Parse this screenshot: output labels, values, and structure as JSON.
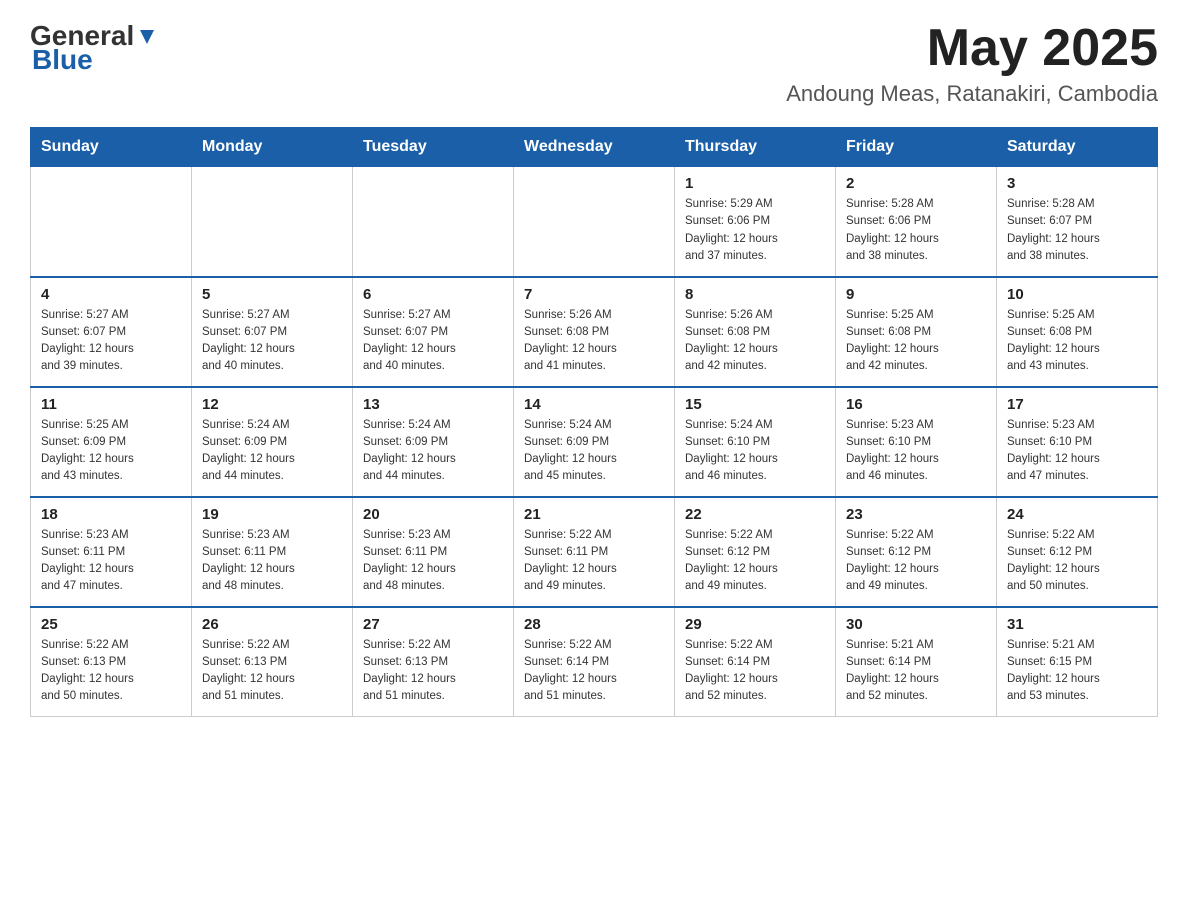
{
  "header": {
    "logo_general": "General",
    "logo_blue": "Blue",
    "month_year": "May 2025",
    "location": "Andoung Meas, Ratanakiri, Cambodia"
  },
  "days_of_week": [
    "Sunday",
    "Monday",
    "Tuesday",
    "Wednesday",
    "Thursday",
    "Friday",
    "Saturday"
  ],
  "weeks": [
    {
      "days": [
        {
          "number": "",
          "info": ""
        },
        {
          "number": "",
          "info": ""
        },
        {
          "number": "",
          "info": ""
        },
        {
          "number": "",
          "info": ""
        },
        {
          "number": "1",
          "info": "Sunrise: 5:29 AM\nSunset: 6:06 PM\nDaylight: 12 hours\nand 37 minutes."
        },
        {
          "number": "2",
          "info": "Sunrise: 5:28 AM\nSunset: 6:06 PM\nDaylight: 12 hours\nand 38 minutes."
        },
        {
          "number": "3",
          "info": "Sunrise: 5:28 AM\nSunset: 6:07 PM\nDaylight: 12 hours\nand 38 minutes."
        }
      ]
    },
    {
      "days": [
        {
          "number": "4",
          "info": "Sunrise: 5:27 AM\nSunset: 6:07 PM\nDaylight: 12 hours\nand 39 minutes."
        },
        {
          "number": "5",
          "info": "Sunrise: 5:27 AM\nSunset: 6:07 PM\nDaylight: 12 hours\nand 40 minutes."
        },
        {
          "number": "6",
          "info": "Sunrise: 5:27 AM\nSunset: 6:07 PM\nDaylight: 12 hours\nand 40 minutes."
        },
        {
          "number": "7",
          "info": "Sunrise: 5:26 AM\nSunset: 6:08 PM\nDaylight: 12 hours\nand 41 minutes."
        },
        {
          "number": "8",
          "info": "Sunrise: 5:26 AM\nSunset: 6:08 PM\nDaylight: 12 hours\nand 42 minutes."
        },
        {
          "number": "9",
          "info": "Sunrise: 5:25 AM\nSunset: 6:08 PM\nDaylight: 12 hours\nand 42 minutes."
        },
        {
          "number": "10",
          "info": "Sunrise: 5:25 AM\nSunset: 6:08 PM\nDaylight: 12 hours\nand 43 minutes."
        }
      ]
    },
    {
      "days": [
        {
          "number": "11",
          "info": "Sunrise: 5:25 AM\nSunset: 6:09 PM\nDaylight: 12 hours\nand 43 minutes."
        },
        {
          "number": "12",
          "info": "Sunrise: 5:24 AM\nSunset: 6:09 PM\nDaylight: 12 hours\nand 44 minutes."
        },
        {
          "number": "13",
          "info": "Sunrise: 5:24 AM\nSunset: 6:09 PM\nDaylight: 12 hours\nand 44 minutes."
        },
        {
          "number": "14",
          "info": "Sunrise: 5:24 AM\nSunset: 6:09 PM\nDaylight: 12 hours\nand 45 minutes."
        },
        {
          "number": "15",
          "info": "Sunrise: 5:24 AM\nSunset: 6:10 PM\nDaylight: 12 hours\nand 46 minutes."
        },
        {
          "number": "16",
          "info": "Sunrise: 5:23 AM\nSunset: 6:10 PM\nDaylight: 12 hours\nand 46 minutes."
        },
        {
          "number": "17",
          "info": "Sunrise: 5:23 AM\nSunset: 6:10 PM\nDaylight: 12 hours\nand 47 minutes."
        }
      ]
    },
    {
      "days": [
        {
          "number": "18",
          "info": "Sunrise: 5:23 AM\nSunset: 6:11 PM\nDaylight: 12 hours\nand 47 minutes."
        },
        {
          "number": "19",
          "info": "Sunrise: 5:23 AM\nSunset: 6:11 PM\nDaylight: 12 hours\nand 48 minutes."
        },
        {
          "number": "20",
          "info": "Sunrise: 5:23 AM\nSunset: 6:11 PM\nDaylight: 12 hours\nand 48 minutes."
        },
        {
          "number": "21",
          "info": "Sunrise: 5:22 AM\nSunset: 6:11 PM\nDaylight: 12 hours\nand 49 minutes."
        },
        {
          "number": "22",
          "info": "Sunrise: 5:22 AM\nSunset: 6:12 PM\nDaylight: 12 hours\nand 49 minutes."
        },
        {
          "number": "23",
          "info": "Sunrise: 5:22 AM\nSunset: 6:12 PM\nDaylight: 12 hours\nand 49 minutes."
        },
        {
          "number": "24",
          "info": "Sunrise: 5:22 AM\nSunset: 6:12 PM\nDaylight: 12 hours\nand 50 minutes."
        }
      ]
    },
    {
      "days": [
        {
          "number": "25",
          "info": "Sunrise: 5:22 AM\nSunset: 6:13 PM\nDaylight: 12 hours\nand 50 minutes."
        },
        {
          "number": "26",
          "info": "Sunrise: 5:22 AM\nSunset: 6:13 PM\nDaylight: 12 hours\nand 51 minutes."
        },
        {
          "number": "27",
          "info": "Sunrise: 5:22 AM\nSunset: 6:13 PM\nDaylight: 12 hours\nand 51 minutes."
        },
        {
          "number": "28",
          "info": "Sunrise: 5:22 AM\nSunset: 6:14 PM\nDaylight: 12 hours\nand 51 minutes."
        },
        {
          "number": "29",
          "info": "Sunrise: 5:22 AM\nSunset: 6:14 PM\nDaylight: 12 hours\nand 52 minutes."
        },
        {
          "number": "30",
          "info": "Sunrise: 5:21 AM\nSunset: 6:14 PM\nDaylight: 12 hours\nand 52 minutes."
        },
        {
          "number": "31",
          "info": "Sunrise: 5:21 AM\nSunset: 6:15 PM\nDaylight: 12 hours\nand 53 minutes."
        }
      ]
    }
  ]
}
